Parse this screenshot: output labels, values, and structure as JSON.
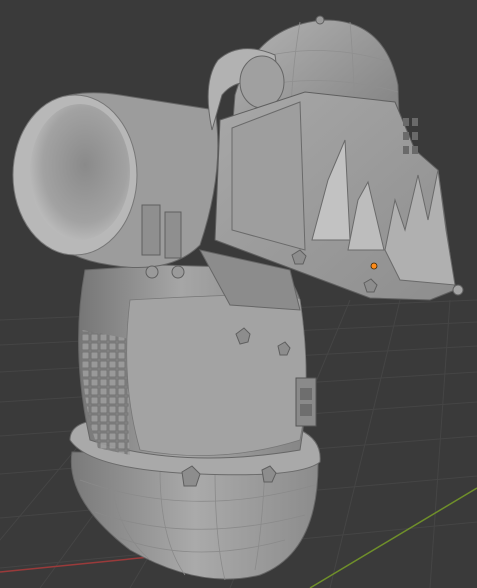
{
  "viewport": {
    "mode": "3d-viewport",
    "background_color": "#3a3a3a",
    "grid_color": "#454545",
    "x_axis_color": "#9a3a3a",
    "y_axis_color": "#6f8f2a",
    "model_color": "#9a9a9a",
    "origin_dot_color": "#ff8c1a"
  },
  "model": {
    "icon": "armored-bust-model",
    "parts": [
      "helmet",
      "horn",
      "face-plate",
      "tusks",
      "shoulder-pad",
      "torso",
      "belt",
      "round-base"
    ]
  }
}
